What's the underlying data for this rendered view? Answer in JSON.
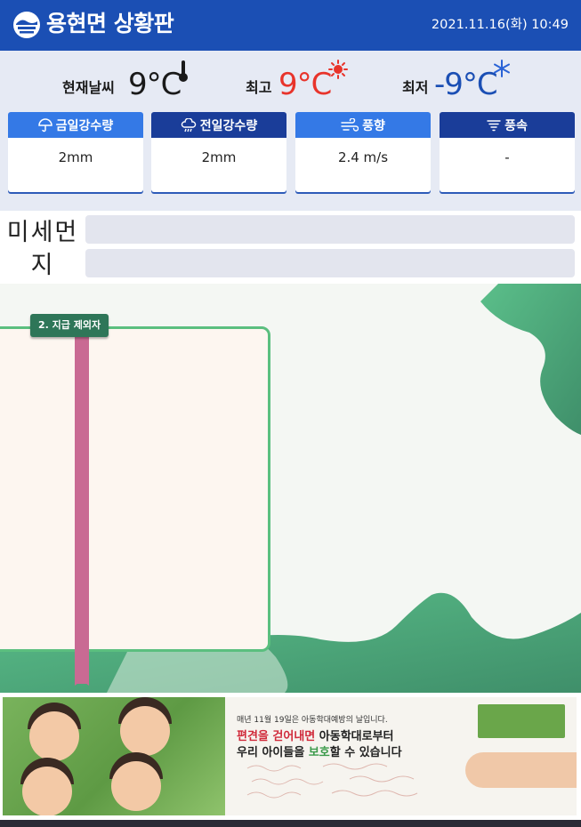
{
  "header": {
    "title": "용현면 상황판",
    "datetime": "2021.11.16(화) 10:49"
  },
  "weather": {
    "current": {
      "label": "현재날씨",
      "value": "9°C",
      "icon": "thermometer-icon"
    },
    "high": {
      "label": "최고",
      "value": "9°C",
      "icon": "sun-icon"
    },
    "low": {
      "label": "최저",
      "value": "-9°C",
      "icon": "snowflake-icon"
    },
    "colors": {
      "current": "#1a1a1a",
      "high": "#e8342b",
      "low": "#1b4fb4"
    }
  },
  "cards": [
    {
      "label": "금일강수량",
      "value": "2mm",
      "icon": "umbrella-icon"
    },
    {
      "label": "전일강수량",
      "value": "2mm",
      "icon": "rain-cloud-icon"
    },
    {
      "label": "풍향",
      "value": "2.4 m/s",
      "icon": "wind-icon"
    },
    {
      "label": "풍속",
      "value": "-",
      "icon": "tornado-icon"
    }
  ],
  "dust": {
    "label": "미세먼지"
  },
  "board": {
    "tag": "2. 지급 제외자"
  },
  "banner": {
    "line1": "매년 11월 19일은 아동학대예방의 날입니다.",
    "line2_a": "편견을 걷어내면",
    "line2_b": " 아동학대로부터",
    "line3_a": "우리 아이들을 ",
    "line3_b": "보호",
    "line3_c": "할 수 있습니다"
  }
}
